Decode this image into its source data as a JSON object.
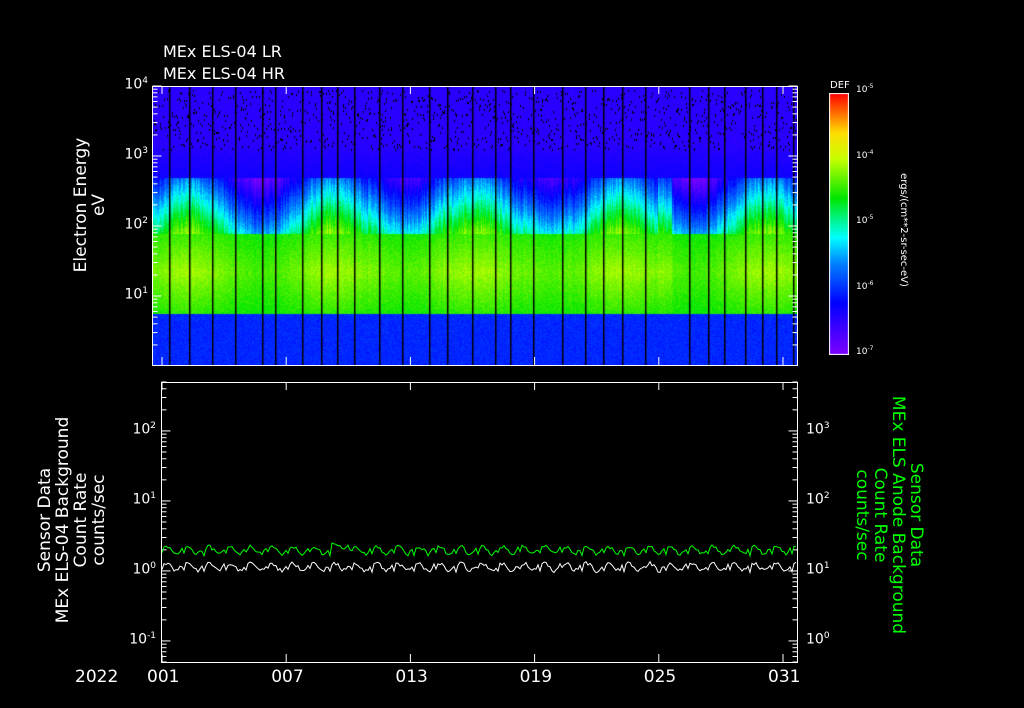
{
  "titles": [
    "MEx ELS-04 LR",
    "MEx ELS-04 HR"
  ],
  "colors": {
    "background": "#000000",
    "axis": "#ffffff",
    "green_series": "#00ff00",
    "white_series": "#ffffff"
  },
  "chart_data": [
    {
      "type": "heatmap",
      "title": "MEx ELS-04 LR / HR",
      "ylabel": [
        "Electron Energy",
        "eV"
      ],
      "yscale": "log",
      "ylim": [
        1,
        10000
      ],
      "yticks": [
        {
          "b": "10",
          "e": "4",
          "v": 10000
        },
        {
          "b": "10",
          "e": "3",
          "v": 1000
        },
        {
          "b": "10",
          "e": "2",
          "v": 100
        },
        {
          "b": "10",
          "e": "1",
          "v": 10
        }
      ],
      "x_days": [
        0.5,
        31.5
      ],
      "colorbar": {
        "label": "DEF",
        "units": "ergs/(cm**2-sr-sec-eV)",
        "range": [
          1e-07,
          1e-05
        ],
        "ticks": [
          {
            "b": "10",
            "e": "-5"
          },
          {
            "b": "10",
            "e": "-4"
          },
          {
            "b": "10",
            "e": "-5"
          },
          {
            "b": "10",
            "e": "-6"
          },
          {
            "b": "10",
            "e": "-7"
          }
        ]
      },
      "data_gap_days": [
        1.3,
        2.3,
        3.4,
        4.5,
        5.8,
        6.4,
        7.7,
        8.6,
        9.4,
        10.2,
        11.4,
        12.5,
        13.8,
        14.7,
        15.9,
        17.0,
        17.7,
        18.8,
        20.2,
        21.3,
        22.2,
        23.1,
        24.2,
        26.3,
        27.2,
        28.0,
        29.0,
        29.8,
        30.5,
        31.3
      ],
      "peak_band_eV": [
        5,
        300
      ]
    },
    {
      "type": "line",
      "ylabel": [
        "Sensor Data",
        "MEx ELS-04 Background",
        "Count Rate",
        "counts/sec"
      ],
      "y2label": [
        "Sensor Data",
        "MEx ELS Anode Background",
        "Count Rate",
        "counts/sec"
      ],
      "yscale": "log",
      "ylim": [
        0.05,
        500
      ],
      "y2lim": [
        0.5,
        5000
      ],
      "yticks": [
        {
          "b": "10",
          "e": "2"
        },
        {
          "b": "10",
          "e": "1"
        },
        {
          "b": "10",
          "e": "0"
        },
        {
          "b": "10",
          "e": "-1"
        }
      ],
      "y2ticks": [
        {
          "b": "10",
          "e": "3"
        },
        {
          "b": "10",
          "e": "2"
        },
        {
          "b": "10",
          "e": "1"
        },
        {
          "b": "10",
          "e": "0"
        }
      ],
      "series": [
        {
          "name": "MEx ELS-04 Background",
          "axis": "left",
          "color": "#ffffff",
          "typical": 1.15
        },
        {
          "name": "MEx ELS Anode Background",
          "axis": "right",
          "color": "#00ff00",
          "typical": 20
        }
      ],
      "xlabel_year": "2022",
      "xticks": [
        "001",
        "007",
        "013",
        "019",
        "025",
        "031"
      ],
      "xtick_days": [
        1,
        7,
        13,
        19,
        25,
        31
      ]
    }
  ]
}
